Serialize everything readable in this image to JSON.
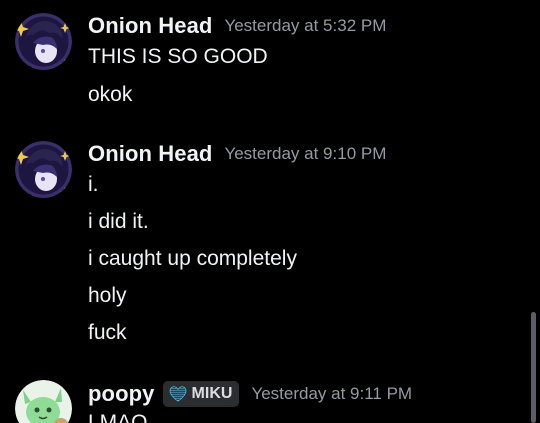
{
  "messages": [
    {
      "author": "Onion Head",
      "timestamp": "Yesterday at 5:32 PM",
      "avatar_icon": "onion-head-avatar",
      "lines": [
        "THIS IS SO GOOD",
        "okok"
      ]
    },
    {
      "author": "Onion Head",
      "timestamp": "Yesterday at 9:10 PM",
      "avatar_icon": "onion-head-avatar",
      "lines": [
        "i.",
        "i did it.",
        "i caught up completely",
        "holy",
        "fuck"
      ]
    },
    {
      "author": "poopy",
      "tag": "MIKU",
      "tag_icon": "heart-icon",
      "timestamp": "Yesterday at 9:11 PM",
      "avatar_icon": "green-creature-avatar",
      "lines": [
        "LMAO"
      ]
    }
  ],
  "colors": {
    "background": "#000000",
    "username": "#f2f3f5",
    "timestamp": "#949ba4",
    "message_text": "#f2f3f5",
    "tag_background": "#2b2d31",
    "tag_heart": "#59c3f5"
  }
}
